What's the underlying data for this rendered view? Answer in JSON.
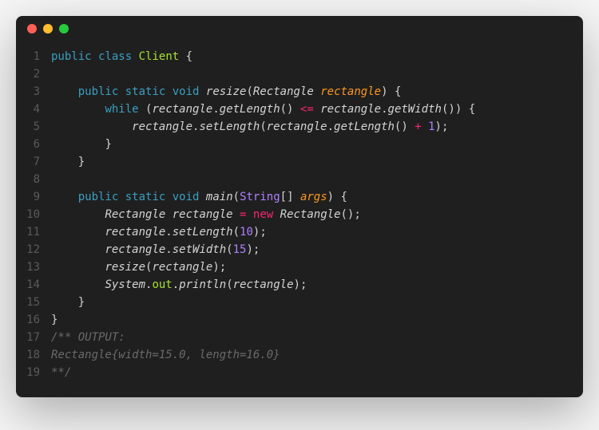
{
  "titlebar": {
    "dots": [
      "red",
      "yellow",
      "green"
    ]
  },
  "code": {
    "lines": [
      {
        "n": 1,
        "tokens": [
          {
            "t": "public",
            "c": "kw"
          },
          {
            "t": " ",
            "c": ""
          },
          {
            "t": "class",
            "c": "kw"
          },
          {
            "t": " ",
            "c": ""
          },
          {
            "t": "Client",
            "c": "cls"
          },
          {
            "t": " ",
            "c": ""
          },
          {
            "t": "{",
            "c": "brace"
          }
        ]
      },
      {
        "n": 2,
        "tokens": []
      },
      {
        "n": 3,
        "tokens": [
          {
            "t": "    ",
            "c": ""
          },
          {
            "t": "public",
            "c": "kw"
          },
          {
            "t": " ",
            "c": ""
          },
          {
            "t": "static",
            "c": "kw"
          },
          {
            "t": " ",
            "c": ""
          },
          {
            "t": "void",
            "c": "kw"
          },
          {
            "t": " ",
            "c": ""
          },
          {
            "t": "resize",
            "c": "fn"
          },
          {
            "t": "(",
            "c": "paren"
          },
          {
            "t": "Rectangle",
            "c": "type"
          },
          {
            "t": " ",
            "c": ""
          },
          {
            "t": "rectangle",
            "c": "param"
          },
          {
            "t": ")",
            "c": "paren"
          },
          {
            "t": " ",
            "c": ""
          },
          {
            "t": "{",
            "c": "brace"
          }
        ]
      },
      {
        "n": 4,
        "tokens": [
          {
            "t": "        ",
            "c": ""
          },
          {
            "t": "while",
            "c": "kw"
          },
          {
            "t": " ",
            "c": ""
          },
          {
            "t": "(",
            "c": "paren"
          },
          {
            "t": "rectangle",
            "c": ""
          },
          {
            "t": ".",
            "c": "punc"
          },
          {
            "t": "getLength",
            "c": "fn"
          },
          {
            "t": "()",
            "c": "paren"
          },
          {
            "t": " ",
            "c": ""
          },
          {
            "t": "<=",
            "c": "op"
          },
          {
            "t": " ",
            "c": ""
          },
          {
            "t": "rectangle",
            "c": ""
          },
          {
            "t": ".",
            "c": "punc"
          },
          {
            "t": "getWidth",
            "c": "fn"
          },
          {
            "t": "()",
            "c": "paren"
          },
          {
            "t": ")",
            "c": "paren"
          },
          {
            "t": " ",
            "c": ""
          },
          {
            "t": "{",
            "c": "brace"
          }
        ]
      },
      {
        "n": 5,
        "tokens": [
          {
            "t": "            ",
            "c": ""
          },
          {
            "t": "rectangle",
            "c": ""
          },
          {
            "t": ".",
            "c": "punc"
          },
          {
            "t": "setLength",
            "c": "fn"
          },
          {
            "t": "(",
            "c": "paren"
          },
          {
            "t": "rectangle",
            "c": ""
          },
          {
            "t": ".",
            "c": "punc"
          },
          {
            "t": "getLength",
            "c": "fn"
          },
          {
            "t": "()",
            "c": "paren"
          },
          {
            "t": " ",
            "c": ""
          },
          {
            "t": "+",
            "c": "op"
          },
          {
            "t": " ",
            "c": ""
          },
          {
            "t": "1",
            "c": "num"
          },
          {
            "t": ")",
            "c": "paren"
          },
          {
            "t": ";",
            "c": "punc"
          }
        ]
      },
      {
        "n": 6,
        "tokens": [
          {
            "t": "        ",
            "c": ""
          },
          {
            "t": "}",
            "c": "brace"
          }
        ]
      },
      {
        "n": 7,
        "tokens": [
          {
            "t": "    ",
            "c": ""
          },
          {
            "t": "}",
            "c": "brace"
          }
        ]
      },
      {
        "n": 8,
        "tokens": []
      },
      {
        "n": 9,
        "tokens": [
          {
            "t": "    ",
            "c": ""
          },
          {
            "t": "public",
            "c": "kw"
          },
          {
            "t": " ",
            "c": ""
          },
          {
            "t": "static",
            "c": "kw"
          },
          {
            "t": " ",
            "c": ""
          },
          {
            "t": "void",
            "c": "kw"
          },
          {
            "t": " ",
            "c": ""
          },
          {
            "t": "main",
            "c": "fn"
          },
          {
            "t": "(",
            "c": "paren"
          },
          {
            "t": "String",
            "c": "builtin"
          },
          {
            "t": "[]",
            "c": "paren"
          },
          {
            "t": " ",
            "c": ""
          },
          {
            "t": "args",
            "c": "param"
          },
          {
            "t": ")",
            "c": "paren"
          },
          {
            "t": " ",
            "c": ""
          },
          {
            "t": "{",
            "c": "brace"
          }
        ]
      },
      {
        "n": 10,
        "tokens": [
          {
            "t": "        ",
            "c": ""
          },
          {
            "t": "Rectangle",
            "c": "type"
          },
          {
            "t": " ",
            "c": ""
          },
          {
            "t": "rectangle",
            "c": ""
          },
          {
            "t": " ",
            "c": ""
          },
          {
            "t": "=",
            "c": "op"
          },
          {
            "t": " ",
            "c": ""
          },
          {
            "t": "new",
            "c": "op"
          },
          {
            "t": " ",
            "c": ""
          },
          {
            "t": "Rectangle",
            "c": "type"
          },
          {
            "t": "()",
            "c": "paren"
          },
          {
            "t": ";",
            "c": "punc"
          }
        ]
      },
      {
        "n": 11,
        "tokens": [
          {
            "t": "        ",
            "c": ""
          },
          {
            "t": "rectangle",
            "c": ""
          },
          {
            "t": ".",
            "c": "punc"
          },
          {
            "t": "setLength",
            "c": "fn"
          },
          {
            "t": "(",
            "c": "paren"
          },
          {
            "t": "10",
            "c": "num"
          },
          {
            "t": ")",
            "c": "paren"
          },
          {
            "t": ";",
            "c": "punc"
          }
        ]
      },
      {
        "n": 12,
        "tokens": [
          {
            "t": "        ",
            "c": ""
          },
          {
            "t": "rectangle",
            "c": ""
          },
          {
            "t": ".",
            "c": "punc"
          },
          {
            "t": "setWidth",
            "c": "fn"
          },
          {
            "t": "(",
            "c": "paren"
          },
          {
            "t": "15",
            "c": "num"
          },
          {
            "t": ")",
            "c": "paren"
          },
          {
            "t": ";",
            "c": "punc"
          }
        ]
      },
      {
        "n": 13,
        "tokens": [
          {
            "t": "        ",
            "c": ""
          },
          {
            "t": "resize",
            "c": "fn"
          },
          {
            "t": "(",
            "c": "paren"
          },
          {
            "t": "rectangle",
            "c": ""
          },
          {
            "t": ")",
            "c": "paren"
          },
          {
            "t": ";",
            "c": "punc"
          }
        ]
      },
      {
        "n": 14,
        "tokens": [
          {
            "t": "        ",
            "c": ""
          },
          {
            "t": "System",
            "c": "type"
          },
          {
            "t": ".",
            "c": "punc"
          },
          {
            "t": "out",
            "c": "cls"
          },
          {
            "t": ".",
            "c": "punc"
          },
          {
            "t": "println",
            "c": "fn"
          },
          {
            "t": "(",
            "c": "paren"
          },
          {
            "t": "rectangle",
            "c": ""
          },
          {
            "t": ")",
            "c": "paren"
          },
          {
            "t": ";",
            "c": "punc"
          }
        ]
      },
      {
        "n": 15,
        "tokens": [
          {
            "t": "    ",
            "c": ""
          },
          {
            "t": "}",
            "c": "brace"
          }
        ]
      },
      {
        "n": 16,
        "tokens": [
          {
            "t": "}",
            "c": "brace"
          }
        ]
      },
      {
        "n": 17,
        "tokens": [
          {
            "t": "/** OUTPUT:",
            "c": "comment"
          }
        ]
      },
      {
        "n": 18,
        "tokens": [
          {
            "t": "Rectangle{width=15.0, length=16.0}",
            "c": "comment"
          }
        ]
      },
      {
        "n": 19,
        "tokens": [
          {
            "t": "**/",
            "c": "comment"
          }
        ]
      }
    ]
  }
}
